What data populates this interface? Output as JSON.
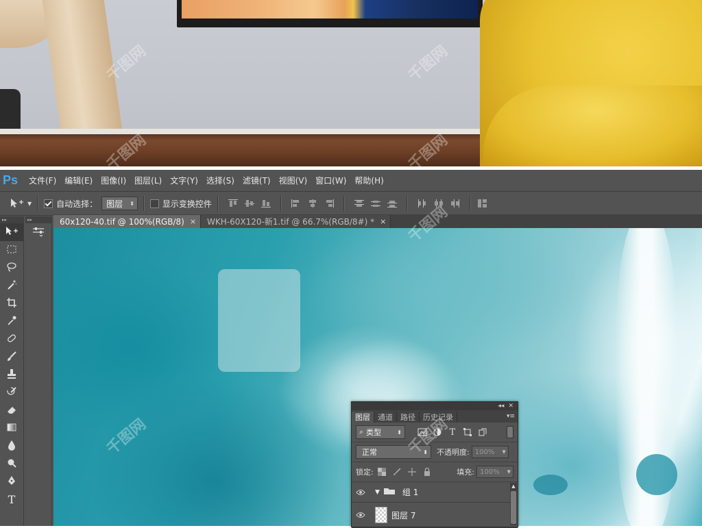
{
  "ps_logo": "Ps",
  "menu": [
    "文件(F)",
    "编辑(E)",
    "图像(I)",
    "图层(L)",
    "文字(Y)",
    "选择(S)",
    "滤镜(T)",
    "视图(V)",
    "窗口(W)",
    "帮助(H)"
  ],
  "options": {
    "auto_select_label": "自动选择：",
    "auto_select_checked": true,
    "auto_select_target": "图层",
    "show_transform_label": "显示变换控件",
    "show_transform_checked": false
  },
  "tabs": [
    {
      "label": "60x120-40.tif @ 100%(RGB/8)",
      "close": "×",
      "active": true
    },
    {
      "label": "WKH-60X120-新1.tif @ 66.7%(RGB/8#) *",
      "close": "×",
      "active": false
    }
  ],
  "tools": [
    "move-tool",
    "marquee-tool",
    "lasso-tool",
    "magic-wand-tool",
    "crop-tool",
    "eyedropper-tool",
    "healing-brush-tool",
    "brush-tool",
    "clone-stamp-tool",
    "history-brush-tool",
    "eraser-tool",
    "gradient-tool",
    "blur-tool",
    "dodge-tool",
    "pen-tool",
    "type-tool"
  ],
  "type_tool_glyph": "T",
  "layers_panel": {
    "tabs": [
      "图层",
      "通道",
      "路径",
      "历史记录"
    ],
    "filter_kind": "类型",
    "blend_mode": "正常",
    "opacity_label": "不透明度:",
    "opacity_value": "100%",
    "lock_label": "锁定:",
    "fill_label": "填充:",
    "fill_value": "100%",
    "layers": [
      {
        "name": "组 1",
        "type": "group",
        "visible": true,
        "expanded": true
      },
      {
        "name": "图层 7",
        "type": "layer",
        "visible": true
      }
    ]
  },
  "watermark": "千图网",
  "colors": {
    "ps_blue": "#4aa7e8",
    "ui_gray": "#535353",
    "accent_teal": "#2a9fae"
  }
}
